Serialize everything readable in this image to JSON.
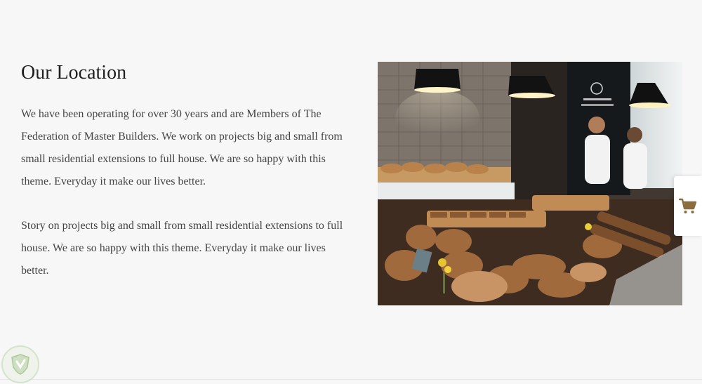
{
  "location": {
    "title": "Our Location",
    "paragraphs": [
      "We have been operating for over 30 years and are Members of The Federation of Master Builders. We work on projects big and small from small residential extensions to full house. We are so happy with this theme. Everyday it make our lives better.",
      "Story on projects big and small from small residential extensions to full house. We are so happy with this theme. Everyday it make our lives better."
    ],
    "image": {
      "subject": "bakery-counter-photo"
    }
  },
  "cart": {
    "icon": "shopping-cart-icon",
    "color": "#8a6d3b"
  },
  "badge": {
    "icon": "shield-logo-icon"
  },
  "colors": {
    "background": "#f7f7f7",
    "title": "#1f1f1f",
    "text": "#444444"
  }
}
